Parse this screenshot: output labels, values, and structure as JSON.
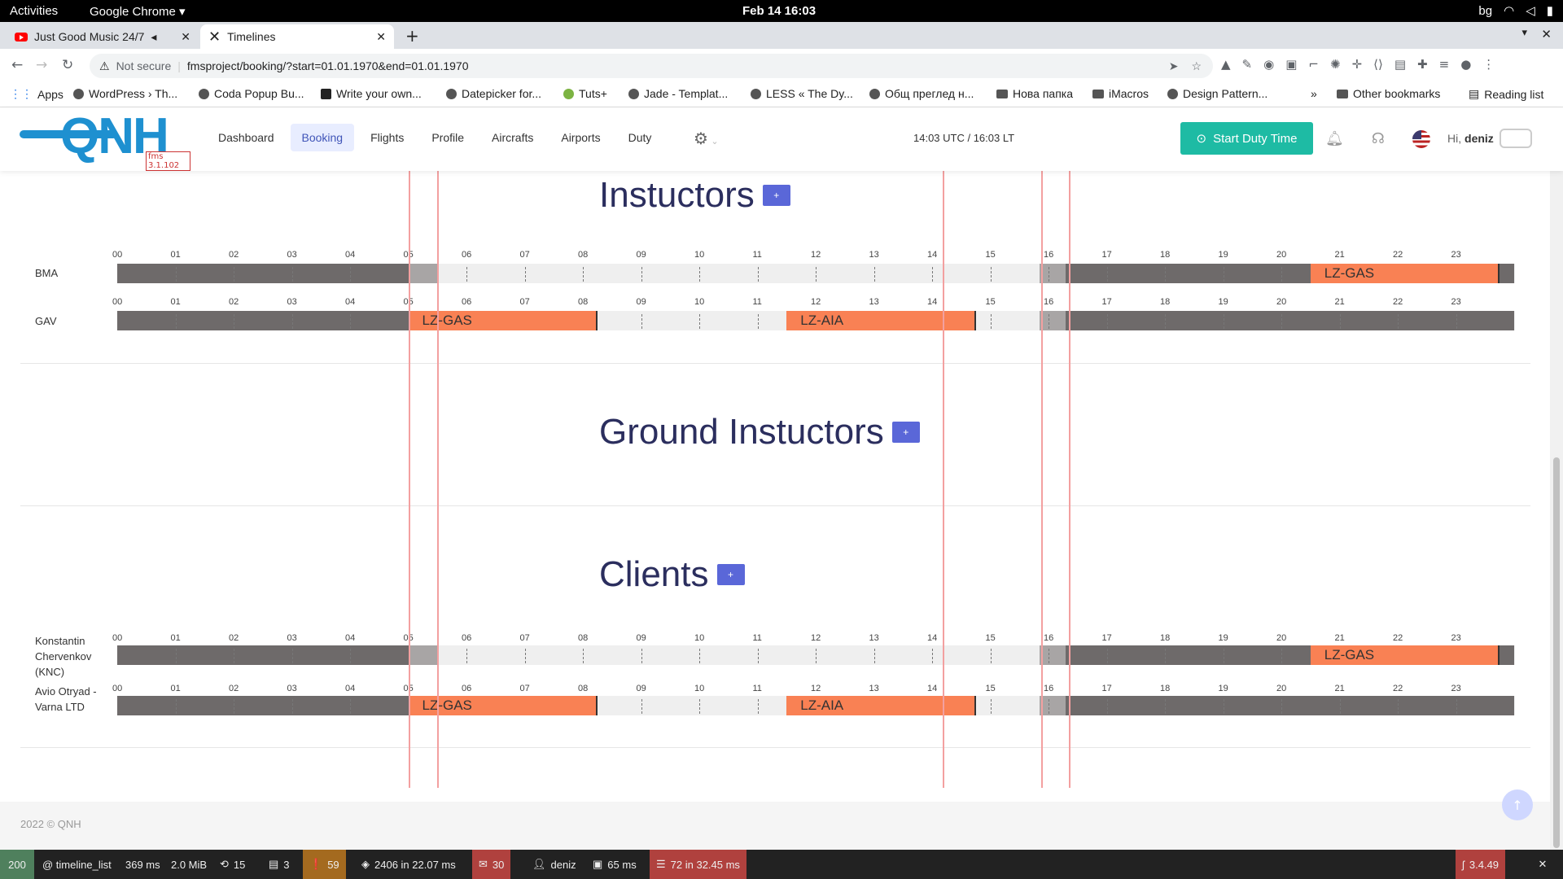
{
  "os": {
    "activities": "Activities",
    "app": "Google Chrome",
    "clock": "Feb 14  16:03",
    "lang": "bg"
  },
  "tabs": [
    {
      "title": "Just Good Music 24/7",
      "icon": "youtube-icon"
    },
    {
      "title": "Timelines",
      "icon": "x-icon"
    }
  ],
  "address": {
    "security": "Not secure",
    "url": "fmsproject/booking/?start=01.01.1970&end=01.01.1970"
  },
  "bookmarks": [
    "Apps",
    "WordPress › Th...",
    "Coda Popup Bu...",
    "Write your own...",
    "Datepicker for...",
    "Tuts+",
    "Jade - Templat...",
    "LESS « The Dy...",
    "Общ преглед н...",
    "Нова папка",
    "iMacros",
    "Design Pattern..."
  ],
  "bookmarks_more": "»",
  "other_bookmarks": "Other bookmarks",
  "reading_list": "Reading list",
  "app": {
    "logo": "QNH",
    "version": "fms 3.1.102",
    "menu": [
      "Dashboard",
      "Booking",
      "Flights",
      "Profile",
      "Aircrafts",
      "Airports",
      "Duty"
    ],
    "active": "Booking",
    "time": "14:03 UTC / 16:03 LT",
    "duty_button": "Start Duty Time",
    "greeting": "Hi,",
    "user": "deniz"
  },
  "hours": [
    "00",
    "01",
    "02",
    "03",
    "04",
    "05",
    "06",
    "07",
    "08",
    "09",
    "10",
    "11",
    "12",
    "13",
    "14",
    "15",
    "16",
    "17",
    "18",
    "19",
    "20",
    "21",
    "22",
    "23"
  ],
  "sections": {
    "instructors": {
      "title": "Instuctors",
      "add": "+",
      "rows": [
        {
          "name": "BMA",
          "bookings": [
            {
              "label": "LZ-GAS",
              "start": 20.5,
              "end": 23.75
            }
          ]
        },
        {
          "name": "GAV",
          "bookings": [
            {
              "label": "LZ-GAS",
              "start": 5,
              "end": 8.25
            },
            {
              "label": "LZ-AIA",
              "start": 11.5,
              "end": 14.75
            }
          ]
        }
      ]
    },
    "ground": {
      "title": "Ground Instuctors",
      "add": "+"
    },
    "clients": {
      "title": "Clients",
      "add": "+",
      "rows": [
        {
          "name": "Konstantin Chervenkov (KNC)",
          "bookings": [
            {
              "label": "LZ-GAS",
              "start": 20.5,
              "end": 23.75
            }
          ]
        },
        {
          "name": "Avio Otryad - Varna LTD",
          "bookings": [
            {
              "label": "LZ-GAS",
              "start": 5,
              "end": 8.25
            },
            {
              "label": "LZ-AIA",
              "start": 11.5,
              "end": 14.75
            }
          ]
        }
      ]
    }
  },
  "footer": "2022 © QNH",
  "profiler": {
    "status": "200",
    "route": "@ timeline_list",
    "time": "369 ms",
    "memory": "2.0 MiB",
    "forms": "15",
    "logs": "3",
    "deprecations": "59",
    "cache": "2406 in 22.07 ms",
    "translations": "30",
    "user": "deniz",
    "twig": "65 ms",
    "db": "72 in 32.45 ms",
    "version": "3.4.49"
  }
}
